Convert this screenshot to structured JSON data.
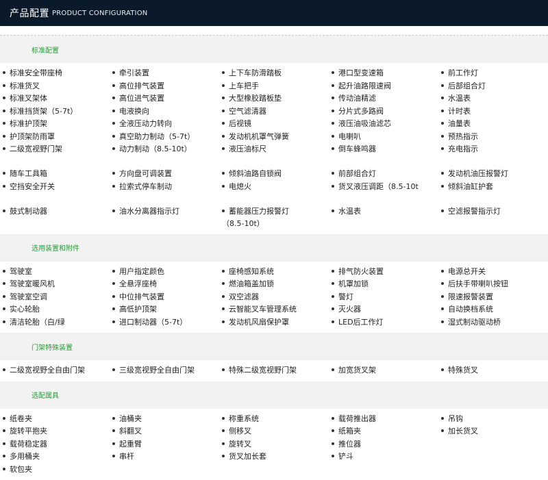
{
  "header": {
    "title_zh": "产品配置",
    "title_en": "PRODUCT CONFIGURATION"
  },
  "sections": [
    {
      "title": "标准配置",
      "rows": [
        [
          "标准安全带座椅",
          "牵引装置",
          "上下车防滑踏板",
          "港口型变速箱",
          "前工作灯"
        ],
        [
          "标准货叉",
          "高位排气装置",
          "上车把手",
          "起升油路限速阀",
          "后部组合灯"
        ],
        [
          "标准叉架体",
          "高位进气装置",
          "大型橡胶踏板垫",
          "传动油精滤",
          "水温表"
        ],
        [
          "标准挡货架（5-7t）",
          "电液换向",
          "空气滤清器",
          "分片式多路阀",
          "计时表"
        ],
        [
          "标准护顶架",
          "全液压动力转向",
          "后视镜",
          "液压油吸油滤芯",
          "油量表"
        ],
        [
          "护顶架防雨罩",
          "真空助力制动（5-7t）",
          "发动机机罩气弹簧",
          "电喇叭",
          "预热指示"
        ],
        [
          "二级宽视野门架",
          "动力制动（8.5-10t）",
          "液压油标尺",
          "倒车蜂鸣器",
          "充电指示"
        ],
        [
          "随车工具箱",
          "方向盘可调装置",
          "倾斜油路自锁阀",
          "前部组合灯",
          "发动机油压报警灯"
        ],
        [
          "空挡安全开关",
          "拉索式停车制动",
          "电熄火",
          "货叉液压调距（8.5-10t",
          "倾斜油缸护套"
        ],
        [
          "鼓式制动器",
          "油水分离器指示灯",
          "蓄能器压力报警灯（8.5-10t）",
          "水温表",
          "空滤报警指示灯"
        ]
      ]
    },
    {
      "title": "选用装置和附件",
      "rows": [
        [
          "驾驶室",
          "用户指定颜色",
          "座椅感知系统",
          "排气防火装置",
          "电源总开关"
        ],
        [
          "驾驶室暖风机",
          "全悬浮座椅",
          "燃油箱盖加锁",
          "机罩加锁",
          "后扶手带喇叭按钮"
        ],
        [
          "驾驶室空调",
          "中位排气装置",
          "双空滤器",
          "警灯",
          "限速报警装置"
        ],
        [
          "实心轮胎",
          "高低护顶架",
          "云智能叉车管理系统",
          "灭火器",
          "自动换档系统"
        ],
        [
          "清洁轮胎（白/绿",
          "进口制动器（5-7t）",
          "发动机风扇保护罩",
          "LED后工作灯",
          "湿式制动驱动桥"
        ]
      ]
    },
    {
      "title": "门架特殊装置",
      "rows": [
        [
          "二级宽视野全自由门架",
          "三级宽视野全自由门架",
          "特殊二级宽视野门架",
          "加宽货叉架",
          "特殊货叉"
        ]
      ]
    },
    {
      "title": "选配属具",
      "rows": [
        [
          "纸卷夹",
          "油桶夹",
          "称重系统",
          "载荷推出器",
          "吊钩"
        ],
        [
          "旋转平抱夹",
          "斜翻叉",
          "侧移叉",
          "纸箱夹",
          "加长货叉"
        ],
        [
          "载荷稳定器",
          "起重臂",
          "旋转叉",
          "推位器",
          ""
        ],
        [
          "多用桶夹",
          "串杆",
          "货叉加长套",
          "铲斗",
          ""
        ],
        [
          "软包夹",
          "",
          "",
          "",
          ""
        ]
      ]
    }
  ]
}
